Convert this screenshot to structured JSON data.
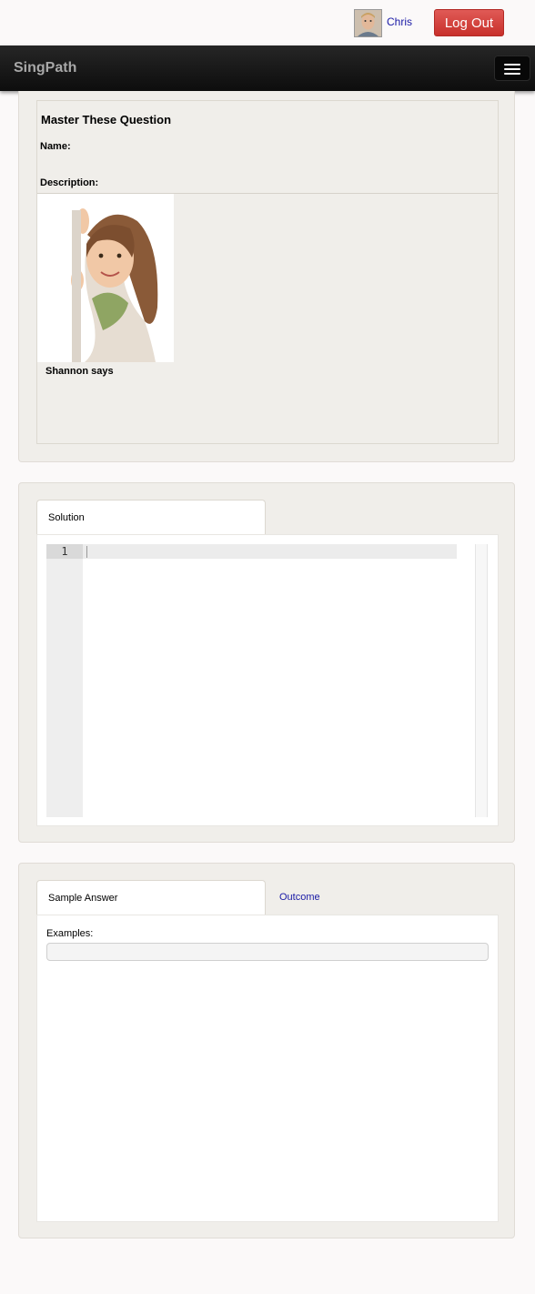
{
  "user": {
    "name": "Chris",
    "logout_label": "Log Out"
  },
  "navbar": {
    "brand": "SingPath",
    "menu_icon": "hamburger-menu-icon"
  },
  "question": {
    "title": "Master These Question",
    "name_label": "Name:",
    "description_label": "Description:",
    "avatar_caption": "Shannon says"
  },
  "solution": {
    "tab_label": "Solution",
    "line_numbers": [
      "1"
    ]
  },
  "results": {
    "tabs": [
      {
        "label": "Sample Answer",
        "active": true
      },
      {
        "label": "Outcome",
        "active": false
      }
    ],
    "examples_label": "Examples:"
  },
  "colors": {
    "accent_link": "#1a1aa6",
    "logout": "#d9453f",
    "navbar": "#1a1a1a"
  }
}
